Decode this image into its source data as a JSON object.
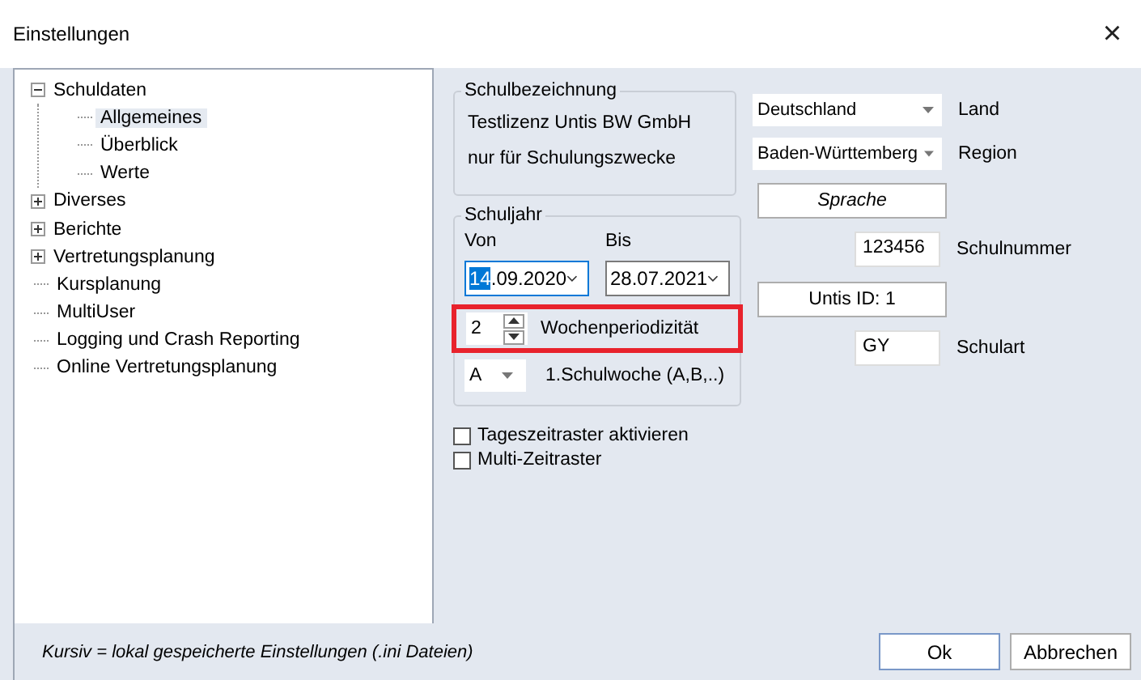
{
  "window": {
    "title": "Einstellungen",
    "close": "×"
  },
  "tree": [
    {
      "label": "Schuldaten",
      "kind": "node",
      "expanded": true,
      "selected": false,
      "children": [
        {
          "label": "Allgemeines",
          "kind": "leaf",
          "selected": true
        },
        {
          "label": "Überblick",
          "kind": "leaf",
          "selected": false
        },
        {
          "label": "Werte",
          "kind": "leaf",
          "selected": false
        }
      ]
    },
    {
      "label": "Diverses",
      "kind": "node",
      "expanded": false,
      "selected": false
    },
    {
      "label": "Berichte",
      "kind": "node",
      "expanded": false,
      "selected": false
    },
    {
      "label": "Vertretungsplanung",
      "kind": "node",
      "expanded": false,
      "selected": false
    },
    {
      "label": "Kursplanung",
      "kind": "leaf",
      "selected": false
    },
    {
      "label": "MultiUser",
      "kind": "leaf",
      "selected": false
    },
    {
      "label": "Logging und Crash Reporting",
      "kind": "leaf",
      "selected": false
    },
    {
      "label": "Online Vertretungsplanung",
      "kind": "leaf",
      "selected": false
    }
  ],
  "schulbezeichnung": {
    "title": "Schulbezeichnung",
    "lines": [
      "Testlizenz Untis BW GmbH",
      "nur für Schulungszwecke"
    ]
  },
  "schuljahr": {
    "title": "Schuljahr",
    "von": {
      "label": "Von",
      "selected_text": "14",
      "value": ".09.2020",
      "focused": true
    },
    "bis": {
      "label": "Bis",
      "value": "28.07.2021",
      "focused": false
    },
    "periodicity": {
      "value": "2",
      "label": "Wochenperiodizität",
      "highlighted": true
    },
    "first_week": {
      "value": "A",
      "label": "1.Schulwoche (A,B,..)"
    }
  },
  "checkboxes": [
    {
      "label": "Tageszeitraster aktivieren",
      "checked": false
    },
    {
      "label": "Multi-Zeitraster",
      "checked": false
    }
  ],
  "country": {
    "value": "Deutschland",
    "label": "Land"
  },
  "region": {
    "value": "Baden-Württemberg",
    "label": "Region"
  },
  "language_button": "Sprache",
  "school_number": {
    "value": "123456",
    "label": "Schulnummer"
  },
  "untis_id_button": "Untis ID: 1",
  "school_type": {
    "value": "GY",
    "label": "Schulart"
  },
  "footer_note": "Kursiv = lokal gespeicherte Einstellungen (.ini Dateien)",
  "buttons": [
    "Ok",
    "Abbrechen"
  ]
}
